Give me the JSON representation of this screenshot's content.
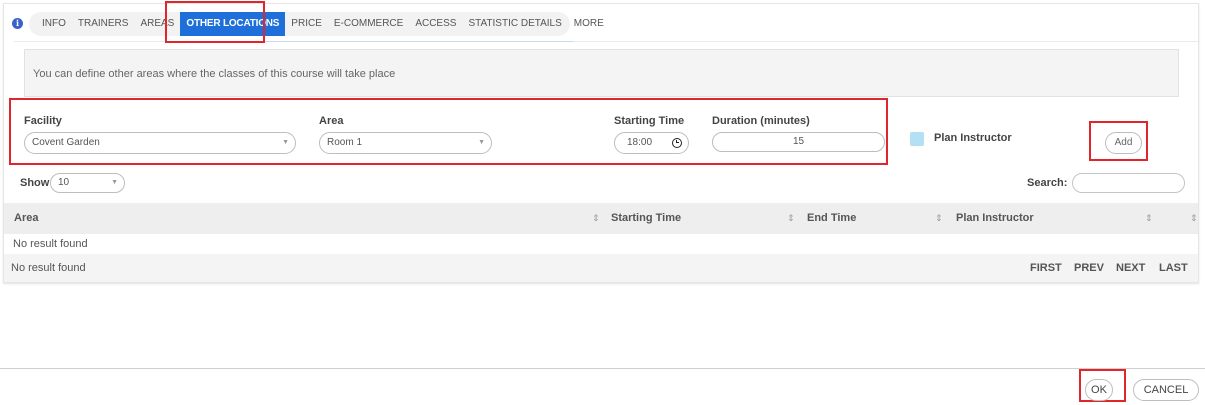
{
  "tabs": {
    "info": "INFO",
    "trainers": "TRAINERS",
    "areas": "AREAS",
    "other_locations": "OTHER LOCATIONS",
    "price": "PRICE",
    "ecommerce": "E-COMMERCE",
    "access": "ACCESS",
    "statistic_details": "STATISTIC DETAILS",
    "more": "MORE",
    "active": "OTHER LOCATIONS"
  },
  "hint": "You can define other areas where the classes of this course will take place",
  "form": {
    "facility_label": "Facility",
    "facility_value": "Covent Garden",
    "area_label": "Area",
    "area_value": "Room 1",
    "starting_time_label": "Starting Time",
    "starting_time_value": "18:00",
    "duration_label": "Duration (minutes)",
    "duration_value": "15",
    "plan_instructor_label": "Plan Instructor",
    "add_label": "Add"
  },
  "table": {
    "show_label": "Show",
    "show_value": "10",
    "search_label": "Search:",
    "search_value": "",
    "columns": [
      "Area",
      "Starting Time",
      "End Time",
      "Plan Instructor"
    ],
    "empty_message": "No result found",
    "footer_info": "No result found",
    "pagination": {
      "first": "FIRST",
      "prev": "PREV",
      "next": "NEXT",
      "last": "LAST"
    }
  },
  "dialog": {
    "ok_label": "OK",
    "cancel_label": "CANCEL"
  },
  "colors": {
    "accent": "#1e6fd9",
    "highlight": "#e0262b",
    "checkbox": "#b3e0f2"
  }
}
